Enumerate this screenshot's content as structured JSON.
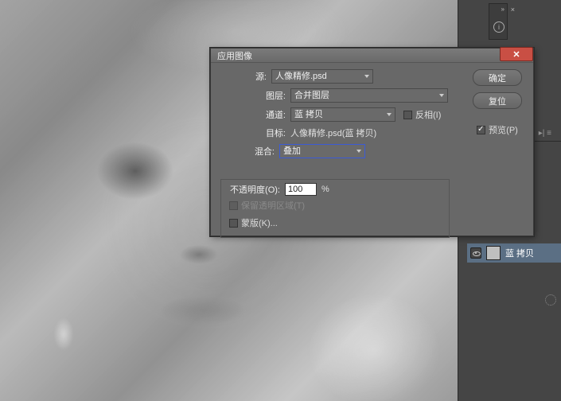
{
  "dialog": {
    "title": "应用图像",
    "source_label": "源:",
    "source_value": "人像精修.psd",
    "layer_label": "图层:",
    "layer_value": "合并图层",
    "channel_label": "通道:",
    "channel_value": "蓝 拷贝",
    "invert_label": "反相(I)",
    "target_label": "目标:",
    "target_value": "人像精修.psd(蓝 拷贝)",
    "blend_label": "混合:",
    "blend_value": "叠加",
    "opacity_label": "不透明度(O):",
    "opacity_value": "100",
    "opacity_pct": "%",
    "preserve_label": "保留透明区域(T)",
    "mask_label": "蒙版(K)...",
    "ok": "确定",
    "reset": "复位",
    "preview": "预览(P)",
    "close": "✕"
  },
  "panel": {
    "layer_name": "蓝 拷贝",
    "info_icon": "i",
    "tabs_hint": "▸| ≡"
  }
}
